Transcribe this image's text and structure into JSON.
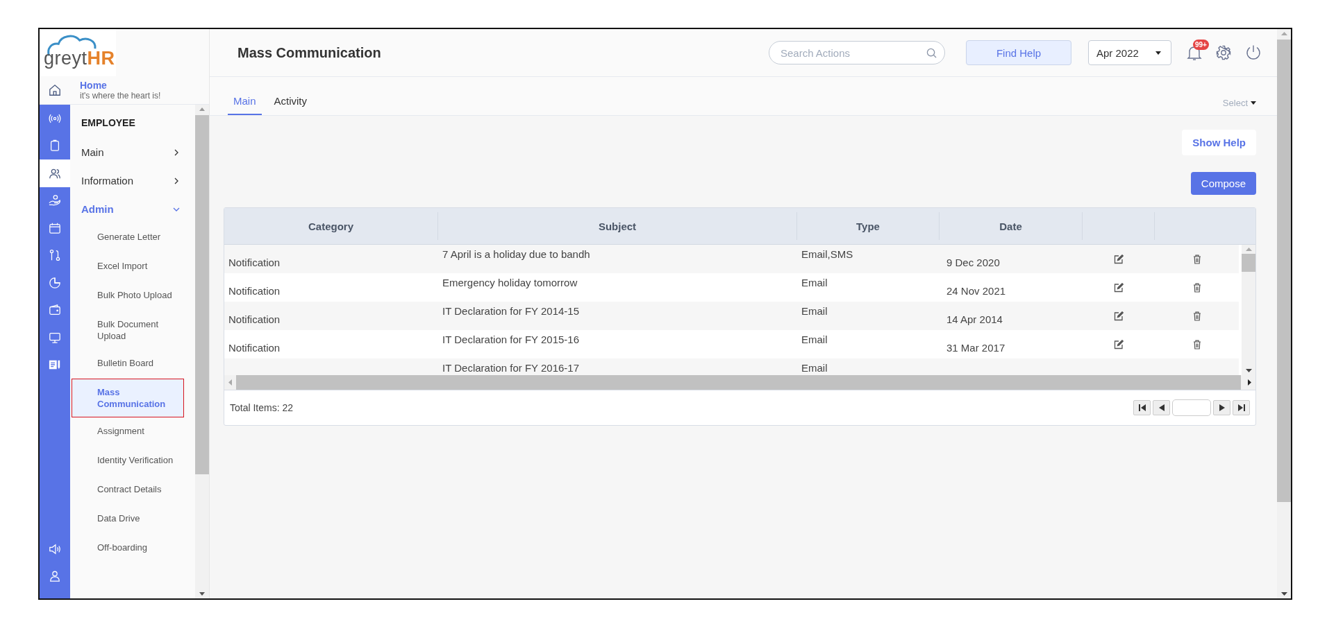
{
  "logo": {
    "text": "greyt",
    "accent": "HR"
  },
  "header": {
    "title": "Mass Communication",
    "search": {
      "placeholder": "Search Actions"
    },
    "find_help": "Find Help",
    "period": "Apr 2022",
    "notification_badge": "99+"
  },
  "home": {
    "title": "Home",
    "subtitle": "it's where the heart is!"
  },
  "rail": [
    {
      "kind": "broadcast",
      "selected": false
    },
    {
      "kind": "clipboard",
      "selected": false
    },
    {
      "kind": "people",
      "selected": true
    },
    {
      "kind": "hand",
      "selected": false
    },
    {
      "kind": "calendar",
      "selected": false
    },
    {
      "kind": "route",
      "selected": false
    },
    {
      "kind": "pie",
      "selected": false
    },
    {
      "kind": "wallet",
      "selected": false
    },
    {
      "kind": "monitor",
      "selected": false
    },
    {
      "kind": "document",
      "selected": false
    }
  ],
  "rail_bottom": [
    {
      "kind": "speaker",
      "selected": false
    },
    {
      "kind": "person",
      "selected": false
    }
  ],
  "sidebar": {
    "section": "EMPLOYEE",
    "items": [
      {
        "label": "Main",
        "expanded": false
      },
      {
        "label": "Information",
        "expanded": false
      },
      {
        "label": "Admin",
        "expanded": true,
        "children": [
          {
            "label": "Generate Letter",
            "selected": false
          },
          {
            "label": "Excel Import",
            "selected": false
          },
          {
            "label": "Bulk Photo Upload",
            "selected": false
          },
          {
            "label": "Bulk Document Upload",
            "selected": false
          },
          {
            "label": "Bulletin Board",
            "selected": false
          },
          {
            "label": "Mass Communication",
            "selected": true
          },
          {
            "label": "Assignment",
            "selected": false
          },
          {
            "label": "Identity Verification",
            "selected": false
          },
          {
            "label": "Contract Details",
            "selected": false
          },
          {
            "label": "Data Drive",
            "selected": false
          },
          {
            "label": "Off-boarding",
            "selected": false
          }
        ]
      }
    ]
  },
  "tabs": [
    {
      "label": "Main",
      "selected": true
    },
    {
      "label": "Activity",
      "selected": false
    }
  ],
  "select_menu": "Select",
  "show_help": "Show Help",
  "compose": "Compose",
  "table": {
    "columns": [
      "Category",
      "Subject",
      "Type",
      "Date"
    ],
    "rows": [
      {
        "category": "Notification",
        "subject": "7 April is a holiday due to bandh",
        "type": "Email,SMS",
        "date": "9 Dec 2020",
        "partial": false
      },
      {
        "category": "Notification",
        "subject": "Emergency holiday tomorrow",
        "type": "Email",
        "date": "24 Nov 2021",
        "partial": false
      },
      {
        "category": "Notification",
        "subject": "IT Declaration for FY 2014-15",
        "type": "Email",
        "date": "14 Apr 2014",
        "partial": false
      },
      {
        "category": "Notification",
        "subject": "IT Declaration for FY 2015-16",
        "type": "Email",
        "date": "31 Mar 2017",
        "partial": false
      },
      {
        "subject": "IT Declaration for FY 2016-17",
        "type": "Email",
        "partial": true
      }
    ],
    "total": "Total Items: 22"
  }
}
